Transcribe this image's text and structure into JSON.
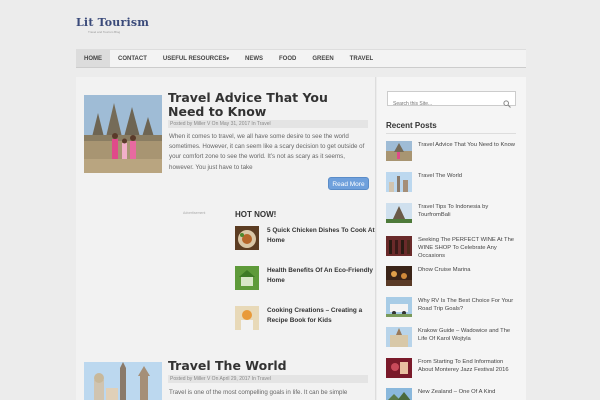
{
  "site": {
    "name": "Lit Tourism",
    "tagline": "Travel and Tourism Blog"
  },
  "nav": {
    "items": [
      "HOME",
      "CONTACT",
      "USEFUL RESOURCES",
      "NEWS",
      "FOOD",
      "GREEN",
      "TRAVEL"
    ],
    "active": "HOME",
    "dropdown_marker": "▾"
  },
  "posts": [
    {
      "title": "Travel Advice That You Need to Know",
      "meta": "Posted by Miller V On May 31, 2017 In Travel",
      "excerpt": "When it comes to travel, we all have some desire to see the world sometimes. However, it can seem like a scary decision to get outside of your comfort zone to see the world. It’s not as scary as it seems, however. You just have to take",
      "read_more": "Read More"
    },
    {
      "title": "Travel The World",
      "meta": "Posted by Miller V On April 29, 2017 In Travel",
      "excerpt": "Travel is one of the most compelling goals in life. It can be simple"
    }
  ],
  "ad_label": "Advertisement",
  "hot_now": {
    "title": "HOT NOW!",
    "items": [
      "5 Quick Chicken Dishes To Cook At Home",
      "Health Benefits Of An Eco-Friendly Home",
      "Cooking Creations – Creating a Recipe Book for Kids"
    ]
  },
  "search": {
    "placeholder": "Search this Site..."
  },
  "recent_posts": {
    "title": "Recent Posts",
    "items": [
      "Travel Advice That You Need to Know",
      "Travel The World",
      "Travel Tips To Indonesia by TourfromBali",
      "Seeking The PERFECT WINE At The WINE SHOP To Celebrate Any Occasions",
      "Dhow Cruise Marina",
      "Why RV Is The Best Choice For Your Road Trip Goals?",
      "Krakow Guide – Wadowice and The Life Of Karol Wojtyla",
      "From Starting To End Information About Monterey Jazz Festival 2016",
      "New Zealand – One Of A Kind"
    ]
  },
  "colors": {
    "accent": "#6fa0dc",
    "logo": "#3a4a7a",
    "background": "#ececec"
  }
}
